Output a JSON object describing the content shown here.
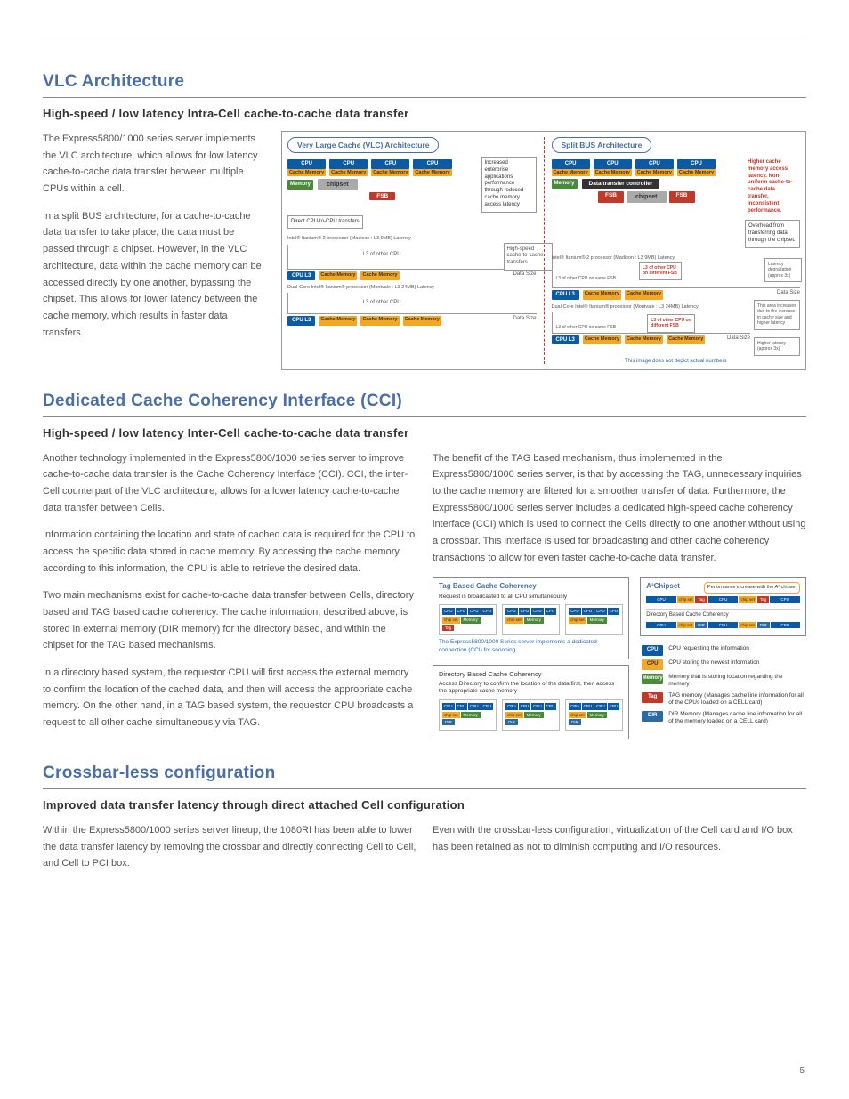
{
  "page_number": "5",
  "section1": {
    "title": "VLC Architecture",
    "subtitle": "High-speed / low latency Intra-Cell cache-to-cache data transfer",
    "para1": "The Express5800/1000 series server implements the VLC architecture, which allows for low latency cache-to-cache data transfer between multiple CPUs within a cell.",
    "para2": "In a split BUS architecture, for a cache-to-cache data transfer to take place, the data must be passed through a chipset. However, in the VLC architecture, data within the cache memory can be accessed directly by one another, bypassing the chipset. This allows for lower latency between the cache memory, which results in faster data transfers.",
    "diagram": {
      "vlc_title": "Very Large Cache (VLC) Architecture",
      "split_title": "Split BUS Architecture",
      "cpu": "CPU",
      "cache": "Cache Memory",
      "memory": "Memory",
      "chipset": "chipset",
      "dtc": "Data transfer controller",
      "fsb": "FSB",
      "note_vlc_perf": "Increased enterprise applications performance through reduced cache memory access latency",
      "note_direct": "Direct CPU-to-CPU transfers",
      "note_highspeed": "High-speed cache-to-cache transfers",
      "note_split_red": "Higher cache memory access latency. Non-uniform cache-to-cache data transfer. Inconsistent performance.",
      "note_overhead": "Overhead from transferring data through the chipset.",
      "note_latency_deg": "Latency degradation (approx 3x)",
      "note_area_inc": "This area increases due to the increase in cache size and higher latency",
      "note_higher_lat": "Higher latency (approx 3x)",
      "proc1": "Intel® Itanium® 2 processor (Madison : L3 9MB) Latency",
      "proc2": "Dual-Core Intel® Itanium® processor (Montvale : L3 24MB) Latency",
      "l3_other": "L3 of other CPU",
      "l3_other_diff": "L3 of other CPU on different FSB",
      "l3_other_same": "L3 of other CPU on same FSB",
      "cpu_l3": "CPU L3",
      "data_size": "Data Size",
      "footer": "This image does not depict actual numbers"
    }
  },
  "section2": {
    "title": "Dedicated Cache Coherency Interface (CCI)",
    "subtitle": "High-speed / low latency Inter-Cell cache-to-cache data transfer",
    "left_p1": "Another technology implemented in the Express5800/1000 series server to improve cache-to-cache data transfer is the Cache Coherency Interface (CCI). CCI, the inter-Cell counterpart of the VLC architecture, allows for a lower latency cache-to-cache data transfer between Cells.",
    "left_p2": "Information containing the location and state of cached data is required for the CPU to access the specific data stored in cache memory. By accessing the cache memory according to this information, the CPU is able to retrieve the desired data.",
    "left_p3": "Two main mechanisms exist for cache-to-cache data transfer between Cells, directory based and TAG based cache coherency. The cache information, described above, is stored in external memory (DIR memory) for the directory based, and within the chipset for the TAG based mechanisms.",
    "left_p4": "In a directory based system, the requestor CPU will first access the external memory to confirm the location of the cached data, and then will access the appropriate cache memory. On the other hand, in a TAG based system, the requestor CPU broadcasts a request to all other cache simultaneously via TAG.",
    "right_p1": "The benefit of the TAG based mechanism, thus implemented in the Express5800/1000 series server, is that by accessing the TAG, unnecessary inquiries to the cache memory are filtered for a smoother transfer of data. Furthermore, the Express5800/1000 series server includes a dedicated high-speed cache coherency interface (CCI) which is used to connect the Cells directly to one another without using a crossbar.   This interface is used for broadcasting and other cache coherency transactions to allow for even faster cache-to-cache data transfer.",
    "diagram": {
      "tag_title": "Tag Based Cache Coherency",
      "tag_desc": "Request is broadcasted to all CPU simultaneously",
      "tag_note": "The Express5800/1000 Series server implements a dedicated connection (CCI) for snooping",
      "dir_title": "Directory Based Cache Coherency",
      "dir_desc": "Access Directory to confirm the location of the data first, then access the appropriate cache memory",
      "a3_title": "A³Chipset",
      "a3_dir_label": "Directory Based Cache Coherency",
      "perf_note": "Performance increase with the A³ chipset",
      "cpu": "CPU",
      "chipset": "chip set",
      "memory": "Memory",
      "tag": "Tag",
      "dir": "DIR",
      "legend_cpu_req": "CPU requesting the information",
      "legend_cpu_store": "CPU storing the newest information",
      "legend_memory": "Memory that is storing location regarding the memory",
      "legend_tag": "TAG memory (Manages cache line information for all of the CPUs loaded on a CELL card)",
      "legend_dir": "DIR Memory (Manages cache line information for all of the memory loaded on a CELL card)"
    }
  },
  "section3": {
    "title": "Crossbar-less configuration",
    "subtitle": "Improved data transfer latency through direct attached Cell configuration",
    "left_p1": "Within the Express5800/1000 series server lineup, the 1080Rf has been able to lower the data transfer latency by removing the crossbar and directly connecting Cell to Cell, and Cell to PCI box.",
    "right_p1": "Even with the crossbar-less configuration, virtualization of the Cell card and I/O box has been retained as not to diminish computing and I/O resources."
  }
}
